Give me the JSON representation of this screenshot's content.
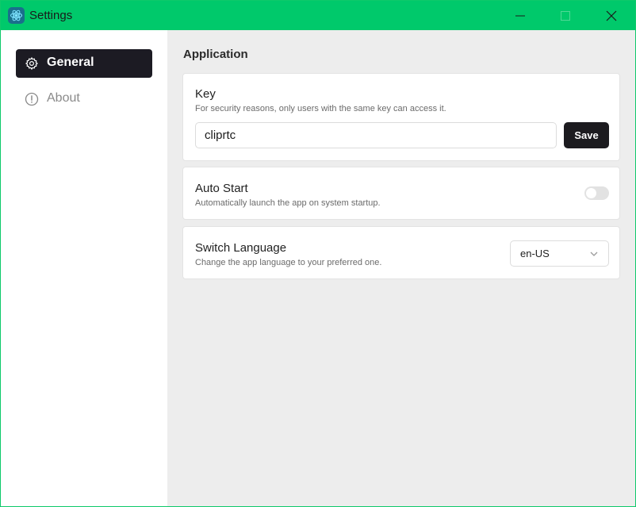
{
  "window": {
    "title": "Settings",
    "accent_color": "#00c96b"
  },
  "sidebar": {
    "items": [
      {
        "label": "General",
        "icon": "gear-icon",
        "active": true
      },
      {
        "label": "About",
        "icon": "info-circle-icon",
        "active": false
      }
    ]
  },
  "main": {
    "section_title": "Application",
    "key": {
      "title": "Key",
      "description": "For security reasons, only users with the same key can access it.",
      "value": "cliprtc",
      "save_label": "Save"
    },
    "auto_start": {
      "title": "Auto Start",
      "description": "Automatically launch the app on system startup.",
      "enabled": false
    },
    "language": {
      "title": "Switch Language",
      "description": "Change the app language to your preferred one.",
      "selected": "en-US"
    }
  }
}
